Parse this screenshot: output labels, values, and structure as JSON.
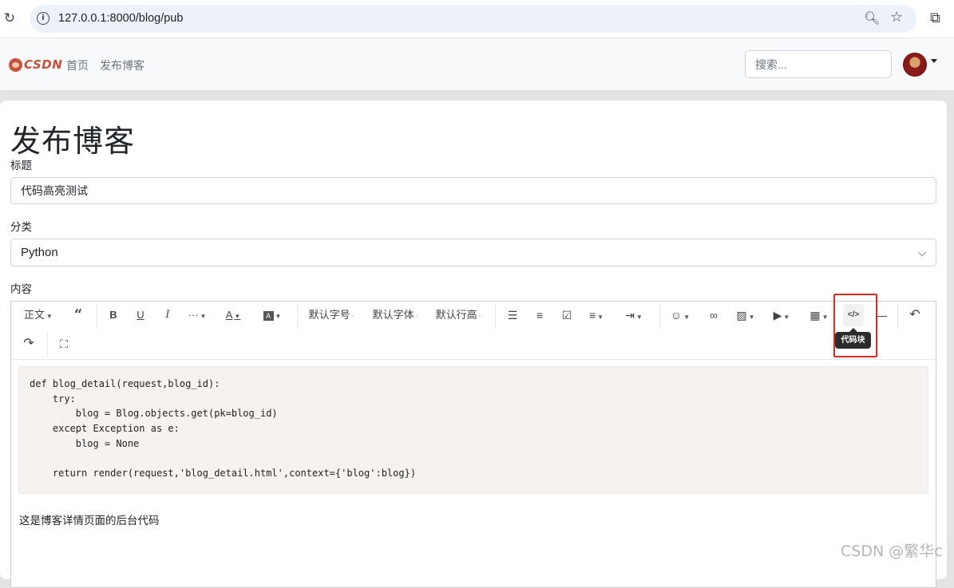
{
  "browser": {
    "url": "127.0.0.1:8000/blog/pub"
  },
  "nav": {
    "logo_text": "CSDN",
    "links": [
      "首页",
      "发布博客"
    ],
    "search_placeholder": "搜索..."
  },
  "page": {
    "title": "发布博客",
    "title_label": "标题",
    "title_value": "代码高亮测试",
    "category_label": "分类",
    "category_value": "Python",
    "content_label": "内容"
  },
  "toolbar": {
    "heading": "正文",
    "font_size": "默认字号",
    "font_family": "默认字体",
    "line_height": "默认行高",
    "code_tooltip": "代码块"
  },
  "editor": {
    "code": "def blog_detail(request,blog_id):\n    try:\n        blog = Blog.objects.get(pk=blog_id)\n    except Exception as e:\n        blog = None\n\n    return render(request,'blog_detail.html',context={'blog':blog})",
    "paragraph": "这是博客详情页面的后台代码"
  },
  "watermark": "CSDN @繁华c"
}
